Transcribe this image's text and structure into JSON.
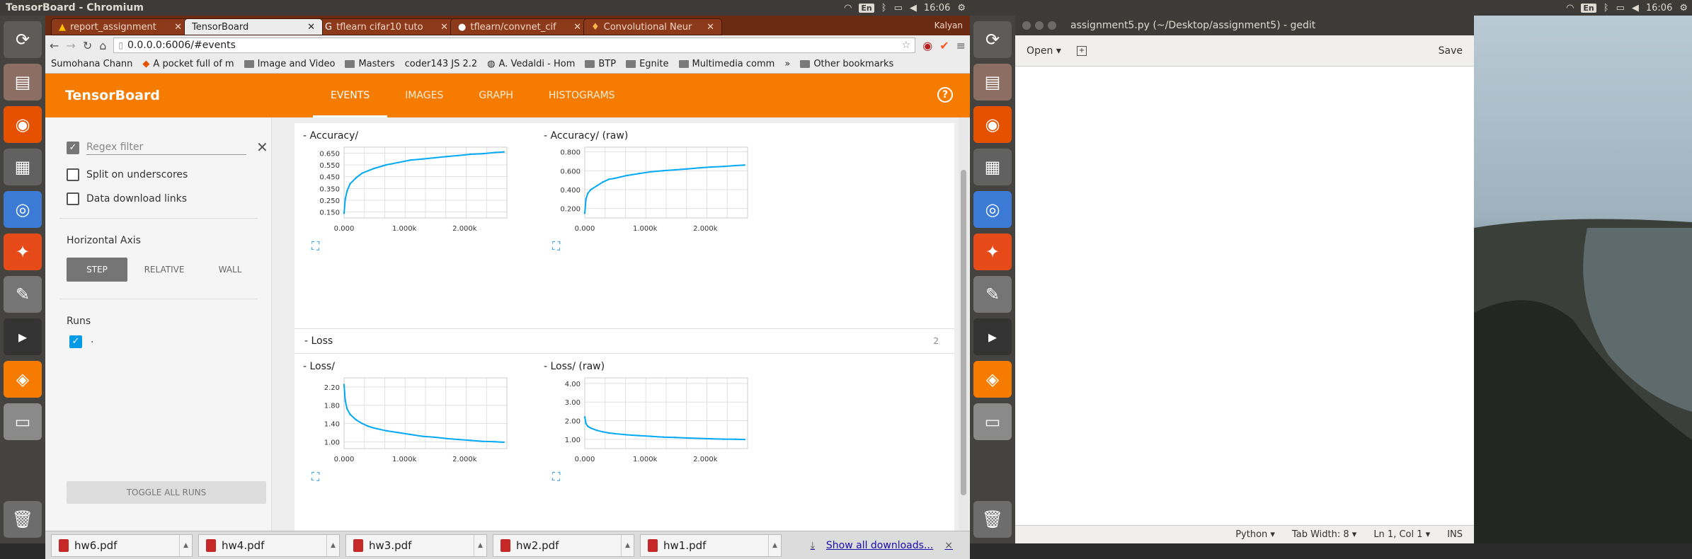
{
  "left_topbar": {
    "title": "TensorBoard - Chromium",
    "clock": "16:06",
    "keyboard": "En"
  },
  "right_topbar": {
    "clock": "16:06",
    "keyboard": "En"
  },
  "launcher": {
    "icons": [
      "ubuntu-icon",
      "files-icon",
      "firefox-icon",
      "calculator-icon",
      "chromium-icon",
      "settings-icon",
      "text-editor-icon",
      "terminal-icon",
      "pdf-reader-icon",
      "drive-icon",
      "trash-icon"
    ]
  },
  "browser": {
    "tabs": [
      {
        "label": "report_assignment"
      },
      {
        "label": "TensorBoard"
      },
      {
        "label": "tflearn cifar10 tuto"
      },
      {
        "label": "tflearn/convnet_cif"
      },
      {
        "label": "Convolutional Neur"
      }
    ],
    "profile_name": "Kalyan",
    "url": "0.0.0.0:6006/#events",
    "bookmarks": [
      "Sumohana Chann",
      "A pocket full of m",
      "Image and Video",
      "Masters",
      "coder143 JS 2.2",
      "A. Vedaldi - Hom",
      "BTP",
      "Egnite",
      "Multimedia comm"
    ],
    "bookmarks_more": "»",
    "other_bookmarks": "Other bookmarks"
  },
  "tensorboard": {
    "brand": "TensorBoard",
    "nav": [
      {
        "label": "EVENTS"
      },
      {
        "label": "IMAGES"
      },
      {
        "label": "GRAPH"
      },
      {
        "label": "HISTOGRAMS"
      }
    ],
    "help_icon": "?",
    "sidebar": {
      "regex_placeholder": "Regex filter",
      "split_label": "Split on underscores",
      "download_label": "Data download links",
      "horizontal_axis_title": "Horizontal Axis",
      "axis_buttons": [
        "STEP",
        "RELATIVE",
        "WALL"
      ],
      "runs_title": "Runs",
      "run_name": ".",
      "toggle_button": "TOGGLE ALL RUNS"
    },
    "loss_section": {
      "title": "- Loss",
      "count": "2"
    }
  },
  "chart_data": [
    {
      "type": "line",
      "title": "- Accuracy/",
      "x_ticks": [
        "0.000",
        "1.000k",
        "2.000k"
      ],
      "y_ticks": [
        "0.150",
        "0.250",
        "0.350",
        "0.450",
        "0.550",
        "0.650"
      ],
      "xlim": [
        0,
        2700
      ],
      "ylim": [
        0.1,
        0.7
      ],
      "color": "#03a9f4",
      "series": [
        {
          "x": [
            0,
            20,
            50,
            100,
            200,
            300,
            400,
            500,
            700,
            900,
            1100,
            1300,
            1500,
            1700,
            1900,
            2100,
            2300,
            2500,
            2650
          ],
          "values": [
            0.14,
            0.26,
            0.33,
            0.39,
            0.44,
            0.48,
            0.5,
            0.52,
            0.55,
            0.57,
            0.59,
            0.6,
            0.61,
            0.62,
            0.63,
            0.64,
            0.645,
            0.655,
            0.66
          ]
        }
      ]
    },
    {
      "type": "line",
      "title": "- Accuracy/ (raw)",
      "x_ticks": [
        "0.000",
        "1.000k",
        "2.000k"
      ],
      "y_ticks": [
        "0.200",
        "0.400",
        "0.600",
        "0.800"
      ],
      "xlim": [
        0,
        2700
      ],
      "ylim": [
        0.1,
        0.85
      ],
      "color": "#03a9f4",
      "series": [
        {
          "x": [
            0,
            20,
            50,
            100,
            200,
            300,
            400,
            500,
            700,
            900,
            1100,
            1300,
            1500,
            1700,
            1900,
            2100,
            2300,
            2500,
            2650
          ],
          "values": [
            0.15,
            0.3,
            0.36,
            0.4,
            0.44,
            0.48,
            0.51,
            0.52,
            0.55,
            0.57,
            0.59,
            0.6,
            0.61,
            0.62,
            0.63,
            0.64,
            0.645,
            0.655,
            0.66
          ]
        }
      ]
    },
    {
      "type": "line",
      "title": "- Loss/",
      "x_ticks": [
        "0.000",
        "1.000k",
        "2.000k"
      ],
      "y_ticks": [
        "1.00",
        "1.40",
        "1.80",
        "2.20"
      ],
      "xlim": [
        0,
        2700
      ],
      "ylim": [
        0.85,
        2.4
      ],
      "color": "#03a9f4",
      "series": [
        {
          "x": [
            0,
            20,
            50,
            100,
            200,
            300,
            400,
            500,
            700,
            900,
            1100,
            1300,
            1500,
            1700,
            1900,
            2100,
            2300,
            2500,
            2650
          ],
          "values": [
            2.25,
            1.9,
            1.72,
            1.6,
            1.48,
            1.4,
            1.34,
            1.3,
            1.24,
            1.2,
            1.16,
            1.12,
            1.1,
            1.07,
            1.05,
            1.03,
            1.01,
            1.0,
            0.99
          ]
        }
      ]
    },
    {
      "type": "line",
      "title": "- Loss/ (raw)",
      "x_ticks": [
        "0.000",
        "1.000k",
        "2.000k"
      ],
      "y_ticks": [
        "1.00",
        "2.00",
        "3.00",
        "4.00"
      ],
      "xlim": [
        0,
        2700
      ],
      "ylim": [
        0.5,
        4.3
      ],
      "color": "#03a9f4",
      "series": [
        {
          "x": [
            0,
            20,
            50,
            100,
            200,
            300,
            400,
            500,
            700,
            900,
            1100,
            1300,
            1500,
            1700,
            1900,
            2100,
            2300,
            2500,
            2650
          ],
          "values": [
            2.2,
            1.85,
            1.7,
            1.6,
            1.48,
            1.4,
            1.34,
            1.3,
            1.24,
            1.2,
            1.16,
            1.12,
            1.1,
            1.07,
            1.05,
            1.03,
            1.01,
            1.0,
            0.99
          ]
        }
      ]
    }
  ],
  "downloads": {
    "files": [
      {
        "name": "hw6.pdf"
      },
      {
        "name": "hw4.pdf"
      },
      {
        "name": "hw3.pdf"
      },
      {
        "name": "hw2.pdf"
      },
      {
        "name": "hw1.pdf"
      }
    ],
    "show_all": "Show all downloads...",
    "close": "×"
  },
  "gedit": {
    "title": "assignment5.py (~/Desktop/assignment5) - gedit",
    "open_label": "Open",
    "save_label": "Save",
    "status": {
      "language": "Python",
      "tab_width": "Tab Width: 8",
      "position": "Ln 1, Col 1",
      "mode": "INS"
    }
  }
}
